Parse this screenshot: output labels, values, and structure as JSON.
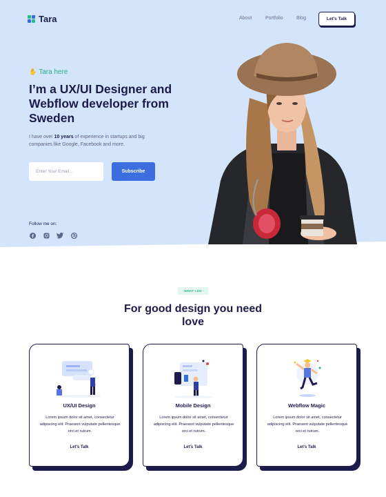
{
  "brand": {
    "name": "Tara"
  },
  "nav": {
    "items": [
      "About",
      "Portfolio",
      "Blog"
    ],
    "cta": "Let's Talk"
  },
  "hero": {
    "greeting": "Tara here",
    "title": "I’m a UX/UI Designer and Webflow developer from Sweden",
    "desc_pre": "I have over ",
    "desc_bold": "10 years",
    "desc_post": " of experience in startups and big companies like Google, Facebook and more.",
    "email_placeholder": "Enter Your Email...",
    "subscribe_label": "Subscribe",
    "follow_label": "Follow me on:",
    "socials": [
      "facebook-icon",
      "instagram-icon",
      "twitter-icon",
      "dribbble-icon"
    ]
  },
  "services": {
    "badge": "WHAT I DO",
    "title": "For good design you need love",
    "cards": [
      {
        "title": "UX/UI Design",
        "text": "Lorem ipsum dolor sit amet, consectetur adipiscing elit. Praesent vulputate pellentesque orci et rutrum.",
        "link": "Let's Talk"
      },
      {
        "title": "Mobile Design",
        "text": "Lorem ipsum dolor sit amet, consectetur adipiscing elit. Praesent vulputate pellentesque orci et rutrum.",
        "link": "Let's Talk"
      },
      {
        "title": "Webflow Magic",
        "text": "Lorem ipsum dolor sit amet, consectetur adipiscing elit. Praesent vulputate pellentesque orci et rutrum.",
        "link": "Let's Talk"
      }
    ]
  },
  "colors": {
    "hero_bg": "#d4e4fb",
    "accent": "#3c6ee0",
    "green": "#27b08a",
    "navy": "#1d1b4b"
  }
}
